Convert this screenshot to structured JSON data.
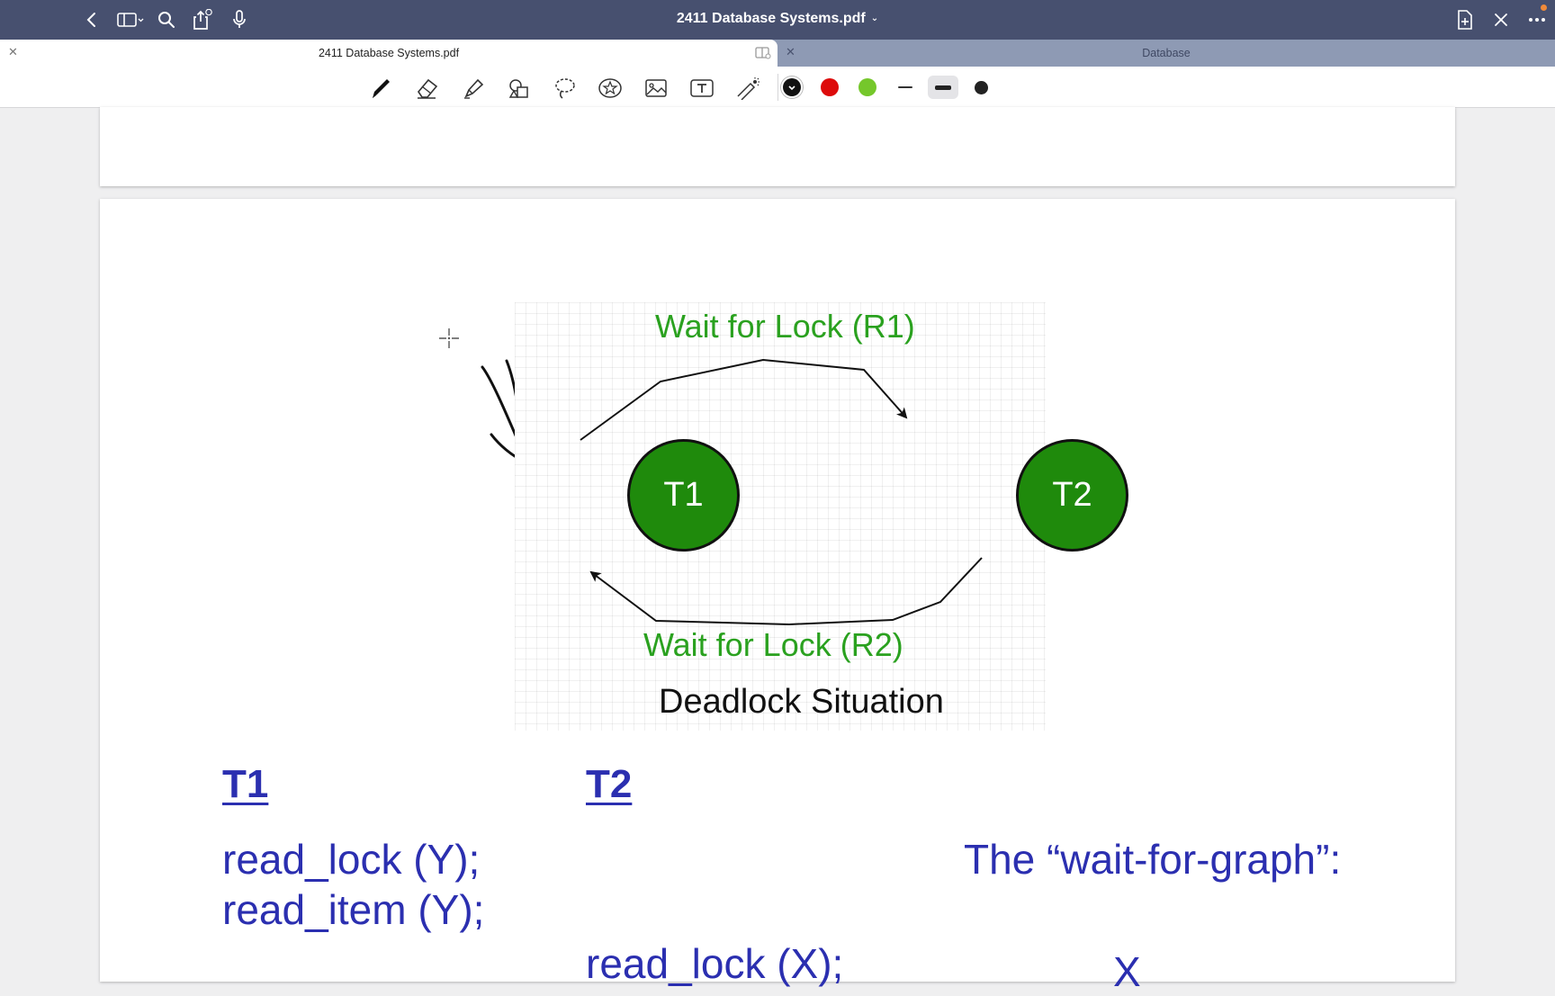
{
  "window": {
    "title": "2411 Database Systems.pdf"
  },
  "tabs": [
    {
      "label": "2411 Database Systems.pdf",
      "active": true
    },
    {
      "label": "Database",
      "active": false
    }
  ],
  "toolbar": {
    "tools": [
      "pen-icon",
      "eraser-icon",
      "highlighter-icon",
      "shapes-icon",
      "lasso-icon",
      "sticker-icon",
      "image-icon",
      "text-box-icon",
      "laser-pointer-icon"
    ],
    "colors": [
      "#111111",
      "#dd0b0b",
      "#75c72b"
    ],
    "selected_color": "#111111"
  },
  "diagram": {
    "edge_top_label": "Wait for Lock (R1)",
    "edge_bottom_label": "Wait for Lock (R2)",
    "caption": "Deadlock Situation",
    "node_left": "T1",
    "node_right": "T2",
    "node_color": "#1f8a0c",
    "label_color": "#2aa11f"
  },
  "content": {
    "t1_heading": "T1",
    "t2_heading": "T2",
    "t1_line1": "read_lock (Y);",
    "t1_line2": "read_item (Y);",
    "t2_line1": "read_lock (X);",
    "wait_for_graph_label": "The “wait-for-graph”:",
    "partial_char": "X"
  }
}
